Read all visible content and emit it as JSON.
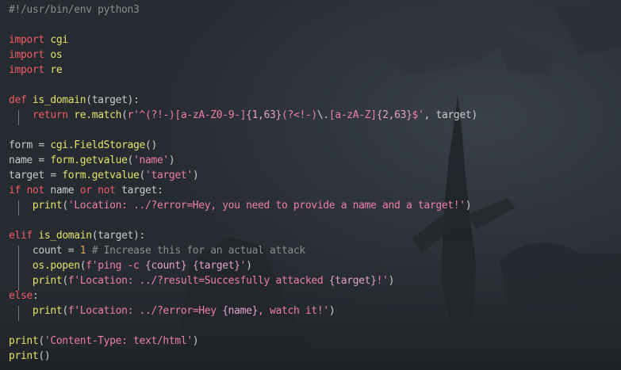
{
  "editor": {
    "lines": [
      [
        {
          "t": "comment",
          "v": "#!/usr/bin/env python3"
        }
      ],
      [],
      [
        {
          "t": "keyword",
          "v": "import"
        },
        {
          "t": "plain",
          "v": " "
        },
        {
          "t": "func",
          "v": "cgi"
        }
      ],
      [
        {
          "t": "keyword",
          "v": "import"
        },
        {
          "t": "plain",
          "v": " "
        },
        {
          "t": "func",
          "v": "os"
        }
      ],
      [
        {
          "t": "keyword",
          "v": "import"
        },
        {
          "t": "plain",
          "v": " "
        },
        {
          "t": "func",
          "v": "re"
        }
      ],
      [],
      [
        {
          "t": "keyword",
          "v": "def"
        },
        {
          "t": "plain",
          "v": " "
        },
        {
          "t": "func",
          "v": "is_domain"
        },
        {
          "t": "plain",
          "v": "(target):"
        }
      ],
      [
        {
          "t": "plain",
          "v": "    "
        },
        {
          "t": "keyword",
          "v": "return"
        },
        {
          "t": "plain",
          "v": " "
        },
        {
          "t": "func",
          "v": "re.match"
        },
        {
          "t": "plain",
          "v": "("
        },
        {
          "t": "string",
          "v": "r'^(?!-)[a-zA-Z0-9-]"
        },
        {
          "t": "brace",
          "v": "{1,63}"
        },
        {
          "t": "string",
          "v": "(?<!-)"
        },
        {
          "t": "escape",
          "v": "\\."
        },
        {
          "t": "string",
          "v": "[a-zA-Z]"
        },
        {
          "t": "brace",
          "v": "{2,63}"
        },
        {
          "t": "string",
          "v": "$'"
        },
        {
          "t": "plain",
          "v": ", target)"
        }
      ],
      [],
      [
        {
          "t": "plain",
          "v": "form = "
        },
        {
          "t": "func",
          "v": "cgi.FieldStorage"
        },
        {
          "t": "plain",
          "v": "()"
        }
      ],
      [
        {
          "t": "plain",
          "v": "name = "
        },
        {
          "t": "func",
          "v": "form.getvalue"
        },
        {
          "t": "plain",
          "v": "("
        },
        {
          "t": "string",
          "v": "'name'"
        },
        {
          "t": "plain",
          "v": ")"
        }
      ],
      [
        {
          "t": "plain",
          "v": "target = "
        },
        {
          "t": "func",
          "v": "form.getvalue"
        },
        {
          "t": "plain",
          "v": "("
        },
        {
          "t": "string",
          "v": "'target'"
        },
        {
          "t": "plain",
          "v": ")"
        }
      ],
      [
        {
          "t": "keyword",
          "v": "if"
        },
        {
          "t": "plain",
          "v": " "
        },
        {
          "t": "keyword",
          "v": "not"
        },
        {
          "t": "plain",
          "v": " name "
        },
        {
          "t": "keyword",
          "v": "or"
        },
        {
          "t": "plain",
          "v": " "
        },
        {
          "t": "keyword",
          "v": "not"
        },
        {
          "t": "plain",
          "v": " target:"
        }
      ],
      [
        {
          "t": "plain",
          "v": "    "
        },
        {
          "t": "func",
          "v": "print"
        },
        {
          "t": "plain",
          "v": "("
        },
        {
          "t": "string",
          "v": "'Location: ../?error=Hey, you need to provide a name and a target!'"
        },
        {
          "t": "plain",
          "v": ")"
        }
      ],
      [],
      [
        {
          "t": "keyword",
          "v": "elif"
        },
        {
          "t": "plain",
          "v": " "
        },
        {
          "t": "func",
          "v": "is_domain"
        },
        {
          "t": "plain",
          "v": "(target):"
        }
      ],
      [
        {
          "t": "plain",
          "v": "    count = "
        },
        {
          "t": "number",
          "v": "1"
        },
        {
          "t": "plain",
          "v": " "
        },
        {
          "t": "comment",
          "v": "# Increase this for an actual attack"
        }
      ],
      [
        {
          "t": "plain",
          "v": "    "
        },
        {
          "t": "func",
          "v": "os.popen"
        },
        {
          "t": "plain",
          "v": "("
        },
        {
          "t": "string",
          "v": "f'ping -c "
        },
        {
          "t": "brace",
          "v": "{count}"
        },
        {
          "t": "string",
          "v": " "
        },
        {
          "t": "brace",
          "v": "{target}"
        },
        {
          "t": "string",
          "v": "'"
        },
        {
          "t": "plain",
          "v": ")"
        }
      ],
      [
        {
          "t": "plain",
          "v": "    "
        },
        {
          "t": "func",
          "v": "print"
        },
        {
          "t": "plain",
          "v": "("
        },
        {
          "t": "string",
          "v": "f'Location: ../?result=Succesfully attacked "
        },
        {
          "t": "brace",
          "v": "{target}"
        },
        {
          "t": "string",
          "v": "!'"
        },
        {
          "t": "plain",
          "v": ")"
        }
      ],
      [
        {
          "t": "keyword",
          "v": "else"
        },
        {
          "t": "plain",
          "v": ":"
        }
      ],
      [
        {
          "t": "plain",
          "v": "    "
        },
        {
          "t": "func",
          "v": "print"
        },
        {
          "t": "plain",
          "v": "("
        },
        {
          "t": "string",
          "v": "f'Location: ../?error=Hey "
        },
        {
          "t": "brace",
          "v": "{name}"
        },
        {
          "t": "string",
          "v": ", watch it!'"
        },
        {
          "t": "plain",
          "v": ")"
        }
      ],
      [],
      [
        {
          "t": "func",
          "v": "print"
        },
        {
          "t": "plain",
          "v": "("
        },
        {
          "t": "string",
          "v": "'Content-Type: text/html'"
        },
        {
          "t": "plain",
          "v": ")"
        }
      ],
      [
        {
          "t": "func",
          "v": "print"
        },
        {
          "t": "plain",
          "v": "()"
        }
      ]
    ]
  },
  "theme": {
    "background": "#262b31",
    "comment": "#8c8c8c",
    "keyword": "#ef5c63",
    "function": "#e3e06a",
    "string": "#ec7eaa",
    "number": "#d9a35f",
    "brace": "#e0a2ca",
    "text": "#c9c9c9"
  }
}
